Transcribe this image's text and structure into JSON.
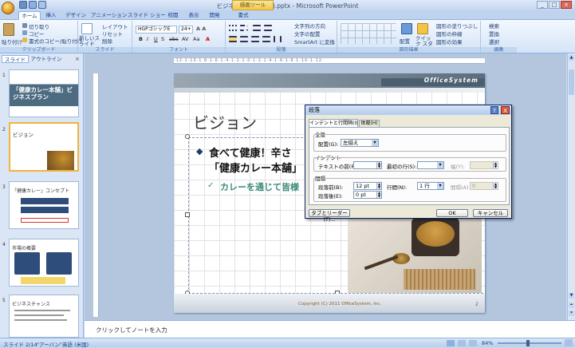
{
  "window": {
    "title": "ビジネスプラン(完成).pptx - Microsoft PowerPoint",
    "context_tab_group": "描画ツール"
  },
  "tabs": [
    "ホーム",
    "挿入",
    "デザイン",
    "アニメーション",
    "スライド ショー",
    "校閲",
    "表示",
    "開発",
    "書式"
  ],
  "ribbon": {
    "clipboard": {
      "paste": "貼り付け",
      "cut": "切り取り",
      "copy": "コピー",
      "format_painter": "書式のコピー/貼り付け",
      "label": "クリップボード"
    },
    "slides": {
      "new_slide": "新しいスライド",
      "layout": "レイアウト",
      "reset": "リセット",
      "delete": "削除",
      "label": "スライド"
    },
    "font": {
      "name": "HGPゴシックE",
      "size": "24+",
      "label": "フォント"
    },
    "paragraph": {
      "text_direction": "文字列の方向",
      "align_text": "文字の配置",
      "smartart": "SmartArt に変換",
      "label": "段落"
    },
    "drawing": {
      "arrange": "配置",
      "quick_styles": "クイック スタイル",
      "shape_fill": "図形の塗りつぶし",
      "shape_outline": "図形の枠線",
      "shape_effects": "図形の効果",
      "label": "図形描画"
    },
    "editing": {
      "find": "検索",
      "replace": "置換",
      "select": "選択",
      "label": "編集"
    }
  },
  "left_panel": {
    "tabs": [
      "スライド",
      "アウトライン"
    ],
    "slides": [
      {
        "num": "1",
        "title": "「健康カレー本舗」ビジネスプラン"
      },
      {
        "num": "2",
        "title": "ビジョン"
      },
      {
        "num": "3",
        "title": "「健康カレー」コンセプト"
      },
      {
        "num": "4",
        "title": "市場の概要"
      },
      {
        "num": "5",
        "title": "ビジネスチャンス"
      }
    ]
  },
  "slide": {
    "brand": "OfficeSystem",
    "title": "ビジョン",
    "bullet1_line1": "食べて健康！辛さ",
    "bullet1_line2": "「健康カレー本舗」",
    "bullet2": "カレーを通じて皆様",
    "footer": "Copyright (C) 2011 OfficeSystem, Inc.",
    "page": "2"
  },
  "notes": {
    "placeholder": "クリックしてノートを入力"
  },
  "status": {
    "slide_info": "スライド 2/14",
    "theme": "\"アーバン\"",
    "language": "英語 (米国)",
    "zoom": "84%"
  },
  "dialog": {
    "title": "段落",
    "tabs": [
      "インデントと行間隔(I)",
      "体裁(H)"
    ],
    "general_label": "全般",
    "alignment_label": "配置(G):",
    "alignment_value": "左揃え",
    "indent_label": "インデント",
    "before_text_label": "テキストの前(R):",
    "before_text_value": "",
    "first_line_label": "最初の行(S):",
    "first_line_value": "",
    "by_label": "幅(Y):",
    "spacing_label": "間隔",
    "before_label": "段落前(B):",
    "before_value": "12 pt",
    "after_label": "段落後(E):",
    "after_value": "0 pt",
    "line_spacing_label": "行間(N):",
    "line_spacing_value": "1 行",
    "at_label": "間隔(A)",
    "at_value": "0",
    "tabs_button": "タブとリーダー(T)...",
    "ok": "OK",
    "cancel": "キャンセル",
    "help": "?",
    "close": "X"
  }
}
